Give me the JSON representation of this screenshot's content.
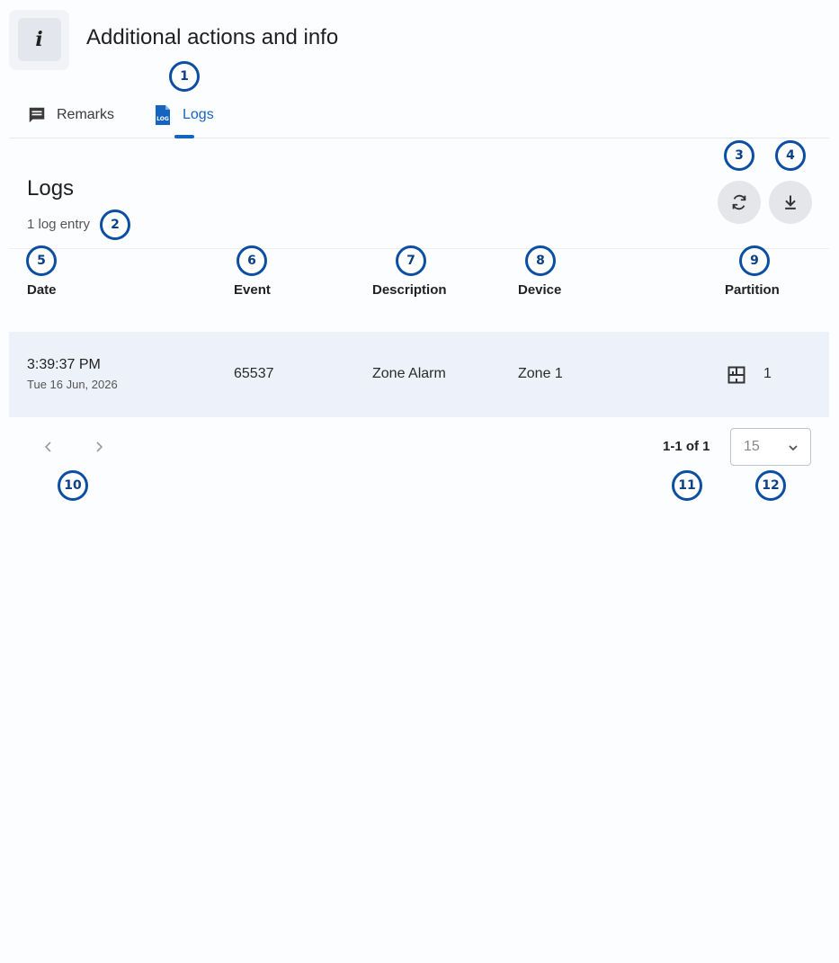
{
  "header": {
    "title": "Additional actions and info",
    "info_icon": "i"
  },
  "tabs": [
    {
      "label": "Remarks",
      "icon": "comment-icon"
    },
    {
      "label": "Logs",
      "icon": "log-file-icon",
      "active": true
    }
  ],
  "logs": {
    "title": "Logs",
    "count_text": "1 log entry",
    "refresh_icon": "refresh-icon",
    "download_icon": "download-icon"
  },
  "table": {
    "columns": [
      "Date",
      "Event",
      "Description",
      "Device",
      "Partition"
    ],
    "rows": [
      {
        "time": "3:39:37 PM",
        "date": "Tue 16 Jun, 2026",
        "event": "65537",
        "description": "Zone Alarm",
        "device": "Zone 1",
        "partition": "1",
        "partition_icon": "partition-icon"
      }
    ]
  },
  "pagination": {
    "range": "1-1 of 1",
    "page_size": "15"
  },
  "badges": [
    "1",
    "2",
    "3",
    "4",
    "5",
    "6",
    "7",
    "8",
    "9",
    "10",
    "11",
    "12"
  ],
  "colors": {
    "accent": "#1565c0",
    "badge_border": "#0b4ea2",
    "row_bg": "#edf2fa"
  }
}
